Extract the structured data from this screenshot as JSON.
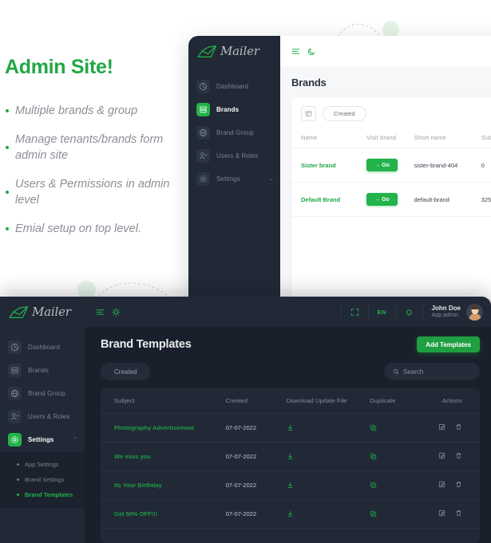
{
  "promo": {
    "heading": "Admin Site!",
    "bullets": [
      "Multiple brands & group",
      "Manage tenants/brands form admin site",
      "Users & Permissions in admin level",
      "Emial setup on top level."
    ]
  },
  "brand": {
    "name": "Mailer"
  },
  "colors": {
    "accent_green": "#22b34a",
    "accent_green_dark": "#1f9f41",
    "heading_green": "#22a745",
    "sidebar_dark": "#212936",
    "panel_dark": "#1a202b",
    "light_bg": "#f6f7f9"
  },
  "top_window": {
    "sidebar": {
      "items": [
        {
          "label": "Dashboard",
          "icon": "pie-chart-icon",
          "active": false
        },
        {
          "label": "Brands",
          "icon": "server-stack-icon",
          "active": true
        },
        {
          "label": "Brand Group",
          "icon": "globe-icon",
          "active": false
        },
        {
          "label": "Users & Roles",
          "icon": "user-check-icon",
          "active": false
        },
        {
          "label": "Settings",
          "icon": "gear-icon",
          "active": false,
          "caret": "⌄"
        }
      ]
    },
    "topbar": {
      "menu_icon": "hamburger-icon",
      "theme_icon": "moon-icon"
    },
    "page_title": "Brands",
    "filter": {
      "grid_icon": "table-layout-icon",
      "chip_label": "Created"
    },
    "table": {
      "columns": [
        "Name",
        "Visit brand",
        "Short name",
        "Subsc"
      ],
      "rows": [
        {
          "name": "Sister brand",
          "visit": "→ Go",
          "short_name": "sister-brand-404",
          "subscribers": "0"
        },
        {
          "name": "Default Brand",
          "visit": "→ Go",
          "short_name": "default-brand",
          "subscribers": "325"
        }
      ]
    }
  },
  "bottom_window": {
    "sidebar": {
      "items": [
        {
          "label": "Dashboard",
          "icon": "pie-chart-icon",
          "active": false
        },
        {
          "label": "Brands",
          "icon": "server-stack-icon",
          "active": false
        },
        {
          "label": "Brand Group",
          "icon": "globe-icon",
          "active": false
        },
        {
          "label": "Users & Roles",
          "icon": "user-check-icon",
          "active": false
        },
        {
          "label": "Settings",
          "icon": "gear-icon",
          "active": true,
          "caret": "⌃"
        }
      ],
      "submenu": [
        {
          "label": "App Settings",
          "active": false
        },
        {
          "label": "Brand Settings",
          "active": false
        },
        {
          "label": "Brand Templates",
          "active": true
        }
      ]
    },
    "topbar": {
      "menu_icon": "hamburger-icon",
      "theme_icon": "sun-icon",
      "fullscreen_icon": "fullscreen-icon",
      "language": "EN",
      "bell_icon": "bell-icon",
      "user_name": "John Doe",
      "user_role": "App admin",
      "avatar": "user-avatar"
    },
    "page_title": "Brand Templates",
    "add_button": "Add Templates",
    "filter_chip": "Created",
    "search": {
      "placeholder": "Search",
      "icon": "search-icon"
    },
    "table": {
      "columns": [
        "Subject",
        "Created",
        "Download Update File",
        "Duplicate",
        "Actions"
      ],
      "rows": [
        {
          "subject": "Photography Advertisement",
          "created": "07-07-2022",
          "download": "download-icon",
          "duplicate": "copy-icon",
          "actions": [
            "edit-icon",
            "trash-icon"
          ]
        },
        {
          "subject": "We miss you",
          "created": "07-07-2022",
          "download": "download-icon",
          "duplicate": "copy-icon",
          "actions": [
            "edit-icon",
            "trash-icon"
          ]
        },
        {
          "subject": "Its Your Birthday",
          "created": "07-07-2022",
          "download": "download-icon",
          "duplicate": "copy-icon",
          "actions": [
            "edit-icon",
            "trash-icon"
          ]
        },
        {
          "subject": "Get 50% OFF!!!",
          "created": "07-07-2022",
          "download": "download-icon",
          "duplicate": "copy-icon",
          "actions": [
            "edit-icon",
            "trash-icon"
          ]
        }
      ]
    }
  }
}
